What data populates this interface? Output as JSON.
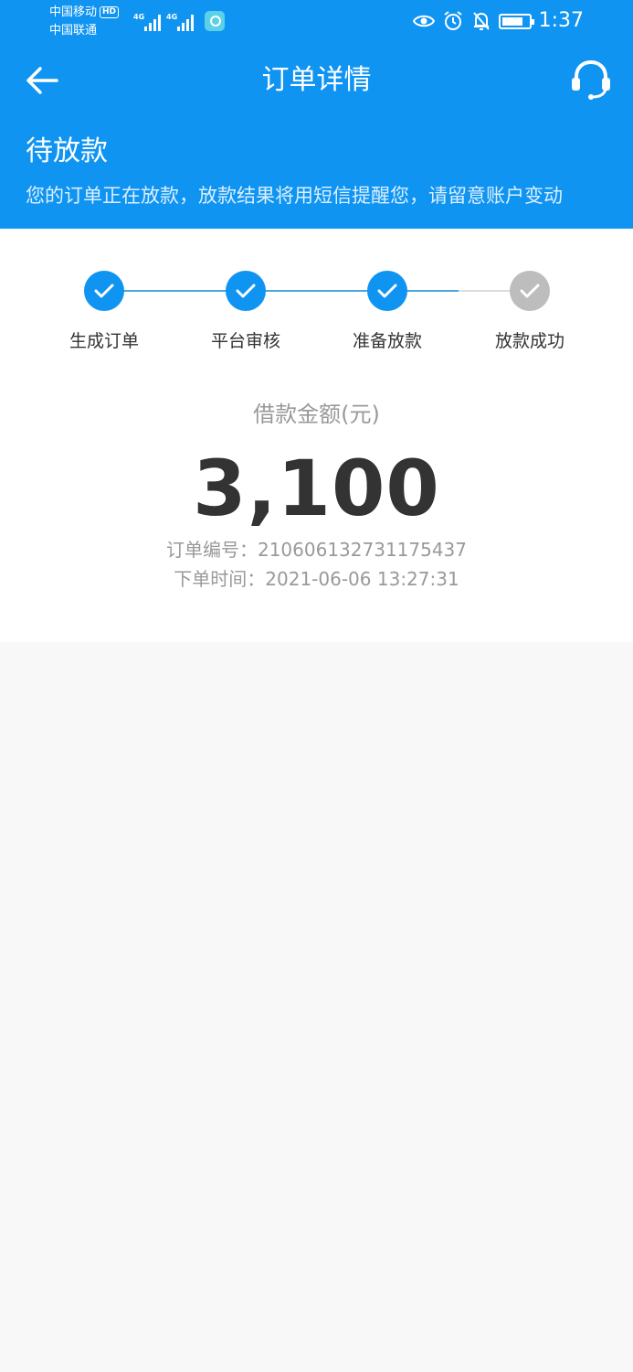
{
  "status_bar": {
    "carrier1": "中国移动",
    "carrier2": "中国联通",
    "hd": "HD",
    "net1": "4G",
    "net2": "4G",
    "time": "1:37"
  },
  "nav": {
    "title": "订单详情"
  },
  "banner": {
    "status": "待放款",
    "description": "您的订单正在放款，放款结果将用短信提醒您，请留意账户变动"
  },
  "steps": [
    {
      "label": "生成订单",
      "done": true
    },
    {
      "label": "平台审核",
      "done": true
    },
    {
      "label": "准备放款",
      "done": true
    },
    {
      "label": "放款成功",
      "done": false
    }
  ],
  "loan": {
    "amount_label": "借款金额(元)",
    "amount": "3,100",
    "order_no": "订单编号：210606132731175437",
    "order_time": "下单时间：2021-06-06 13:27:31"
  },
  "colors": {
    "primary": "#0f94f2",
    "pending": "#bdbdbd"
  }
}
